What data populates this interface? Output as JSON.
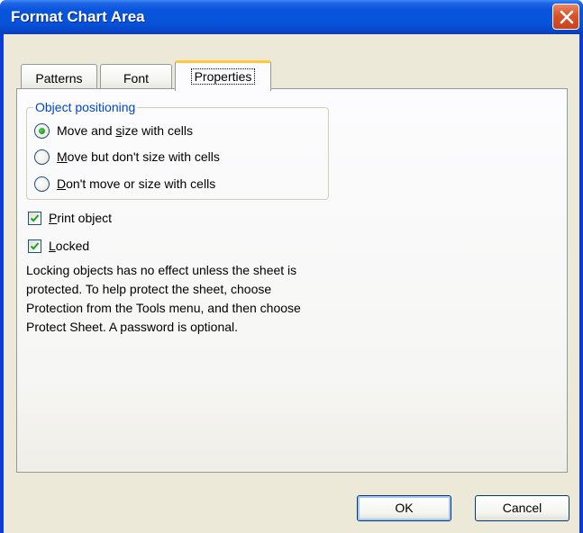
{
  "window": {
    "title": "Format Chart Area",
    "close_icon": "close-icon"
  },
  "tabs": [
    {
      "label": "Patterns",
      "active": false
    },
    {
      "label": "Font",
      "active": false
    },
    {
      "label": "Properties",
      "active": true
    }
  ],
  "object_positioning": {
    "legend": "Object positioning",
    "options": [
      {
        "label": "Move and size with cells",
        "selected": true
      },
      {
        "label": "Move but don't size with cells",
        "selected": false
      },
      {
        "label": "Don't move or size with cells",
        "selected": false
      }
    ]
  },
  "checkboxes": [
    {
      "label": "Print object",
      "checked": true
    },
    {
      "label": "Locked",
      "checked": true
    }
  ],
  "info_lines": [
    "Locking objects has no effect unless the sheet is",
    "protected.  To help protect the sheet, choose",
    "Protection from the Tools menu, and then choose",
    "Protect Sheet.  A password is optional."
  ],
  "buttons": {
    "ok": "OK",
    "cancel": "Cancel"
  },
  "colors": {
    "titlebar": "#0855dd",
    "close_button": "#d8532a",
    "dialog_face": "#ece9d8",
    "group_legend": "#0046d5",
    "active_tab_highlight": "#ffc83c",
    "radio_dot": "#21a121",
    "checkmark": "#21a121"
  }
}
